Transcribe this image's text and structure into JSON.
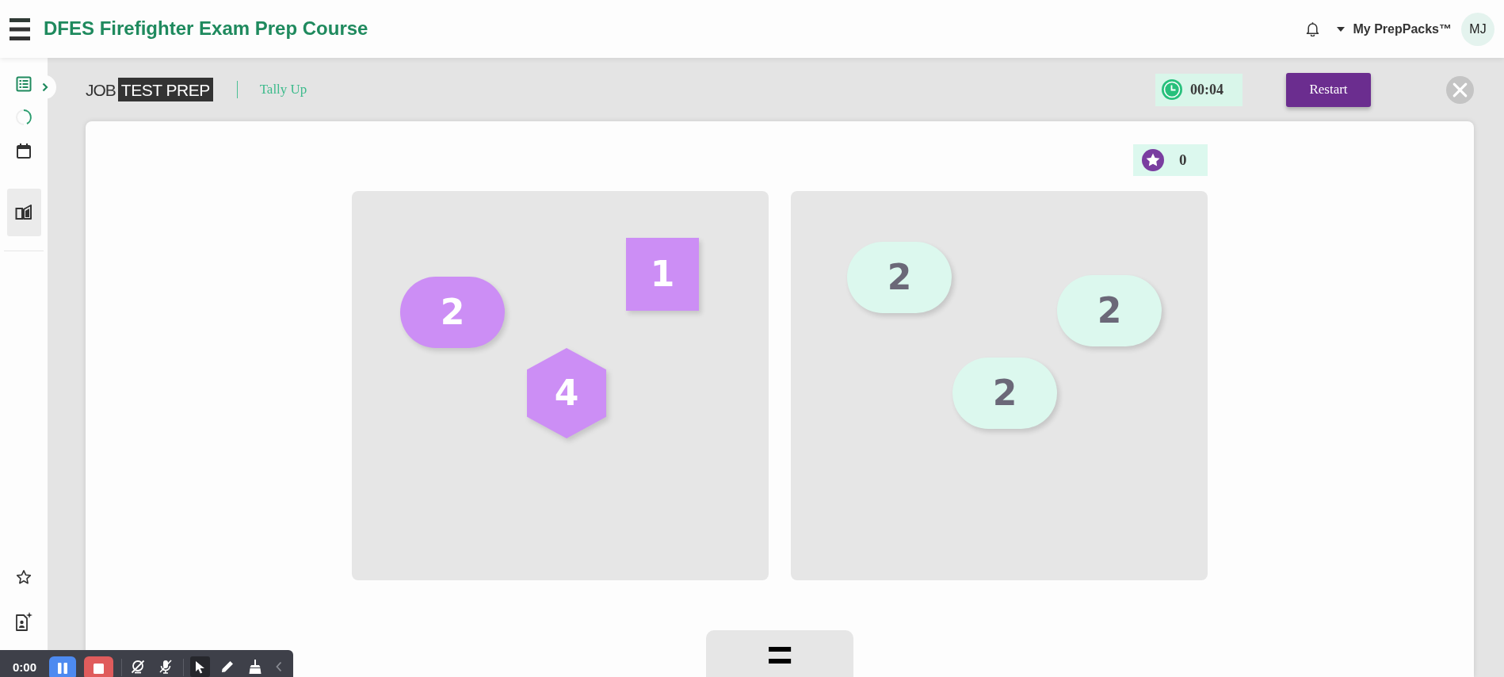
{
  "navbar": {
    "title": "DFES Firefighter Exam Prep Course",
    "menu_label": "My PrepPacks™",
    "avatar": "MJ"
  },
  "sidebar": {
    "top_items": [
      {
        "kind": "list",
        "selected": false
      },
      {
        "kind": "loader",
        "selected": false
      },
      {
        "kind": "calendar",
        "selected": false
      },
      {
        "kind": "book",
        "selected": true
      }
    ],
    "bottom_items": [
      {
        "kind": "star",
        "selected": false
      },
      {
        "kind": "document",
        "selected": false
      }
    ]
  },
  "game": {
    "logo": {
      "plain": "JOB",
      "boxed": "TEST PREP"
    },
    "title": "Tally Up",
    "timer": "00:04",
    "restart_label": "Restart",
    "score": "0",
    "panels": [
      {
        "shapes": [
          {
            "kind": "pill",
            "value": "2",
            "color": "#cc8ef5"
          },
          {
            "kind": "square",
            "value": "1",
            "color": "#cc8ef5"
          },
          {
            "kind": "hexagon",
            "value": "4",
            "color": "#cc8ef5"
          }
        ]
      },
      {
        "shapes": [
          {
            "kind": "pill",
            "value": "2",
            "color": "#dcf8ee"
          },
          {
            "kind": "pill",
            "value": "2",
            "color": "#dcf8ee"
          },
          {
            "kind": "pill",
            "value": "2",
            "color": "#dcf8ee"
          }
        ]
      }
    ],
    "operator": "="
  },
  "recorder": {
    "time": "0:00",
    "controls": [
      {
        "kind": "pause"
      },
      {
        "kind": "stop"
      },
      {
        "kind": "camera-off"
      },
      {
        "kind": "mic-off"
      }
    ],
    "tools": [
      {
        "kind": "pointer",
        "selected": true
      },
      {
        "kind": "pen",
        "selected": false
      },
      {
        "kind": "broom",
        "selected": false
      }
    ]
  }
}
